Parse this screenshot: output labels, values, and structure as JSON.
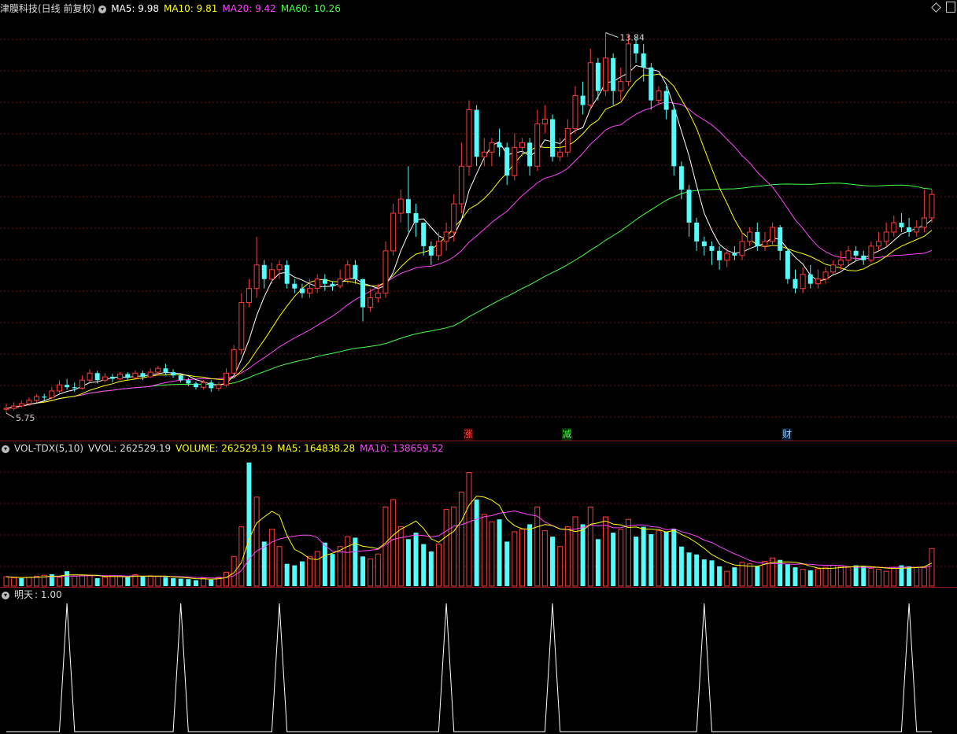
{
  "header_price": {
    "title": "津膜科技(日线 前复权)",
    "ma5": "MA5: 9.98",
    "ma10": "MA10: 9.81",
    "ma20": "MA20: 9.42",
    "ma60": "MA60: 10.26",
    "colors": {
      "title": "#dddddd",
      "ma5": "#ffffff",
      "ma10": "#ffff00",
      "ma20": "#ff44ff",
      "ma60": "#44ff44"
    }
  },
  "header_volume": {
    "name": "VOL-TDX(5,10)",
    "vvol": "VVOL: 262529.19",
    "volume": "VOLUME: 262529.19",
    "ma5": "MA5: 164838.28",
    "ma10": "MA10: 138659.52"
  },
  "header_signal": {
    "name": "明天",
    "value": ": 1.00"
  },
  "annotations": {
    "high_label": "13.84",
    "low_label": "5.75"
  },
  "markers": [
    {
      "label": "涨",
      "color": "#ff4444",
      "bg": "#330000"
    },
    {
      "label": "减",
      "color": "#44ff44",
      "bg": "#003300"
    },
    {
      "label": "财",
      "color": "#88ccff",
      "bg": "#001a33"
    }
  ],
  "colors": {
    "up": "#ff3b3b",
    "down": "#54fcfc",
    "grid": "#6b0f0f",
    "separator": "#8b1a1a",
    "ma5": "#ffffff",
    "ma10": "#ffff00",
    "ma20": "#ff44ff",
    "ma60": "#44ff44",
    "signal": "#ffffff"
  },
  "chart_data": {
    "type": "candlestick",
    "price_range": [
      5.5,
      14.2
    ],
    "volume_range": [
      0,
      262600
    ],
    "candles": [
      [
        5.83,
        5.85,
        5.75,
        5.95
      ],
      [
        5.85,
        5.9,
        5.8,
        5.98
      ],
      [
        5.9,
        5.95,
        5.86,
        6.02
      ],
      [
        5.95,
        6.02,
        5.9,
        6.08
      ],
      [
        6.02,
        6.1,
        5.98,
        6.15
      ],
      [
        6.1,
        6.08,
        6.02,
        6.16
      ],
      [
        6.08,
        6.22,
        6.05,
        6.3
      ],
      [
        6.22,
        6.35,
        6.18,
        6.45
      ],
      [
        6.35,
        6.3,
        6.25,
        6.48
      ],
      [
        6.3,
        6.28,
        6.2,
        6.4
      ],
      [
        6.28,
        6.45,
        6.25,
        6.55
      ],
      [
        6.45,
        6.6,
        6.4,
        6.68
      ],
      [
        6.6,
        6.45,
        6.38,
        6.65
      ],
      [
        6.45,
        6.52,
        6.4,
        6.6
      ],
      [
        6.52,
        6.48,
        6.4,
        6.58
      ],
      [
        6.48,
        6.58,
        6.45,
        6.62
      ],
      [
        6.58,
        6.5,
        6.45,
        6.62
      ],
      [
        6.5,
        6.6,
        6.48,
        6.66
      ],
      [
        6.6,
        6.52,
        6.45,
        6.65
      ],
      [
        6.52,
        6.62,
        6.5,
        6.7
      ],
      [
        6.62,
        6.7,
        6.55,
        6.75
      ],
      [
        6.7,
        6.62,
        6.55,
        6.8
      ],
      [
        6.62,
        6.55,
        6.5,
        6.68
      ],
      [
        6.55,
        6.45,
        6.4,
        6.6
      ],
      [
        6.45,
        6.38,
        6.32,
        6.5
      ],
      [
        6.38,
        6.3,
        6.25,
        6.42
      ],
      [
        6.3,
        6.4,
        6.25,
        6.45
      ],
      [
        6.4,
        6.28,
        6.2,
        6.45
      ],
      [
        6.28,
        6.35,
        6.22,
        6.42
      ],
      [
        6.35,
        6.6,
        6.3,
        6.7
      ],
      [
        6.6,
        7.1,
        6.55,
        7.2
      ],
      [
        7.1,
        8.1,
        7.0,
        8.3
      ],
      [
        8.1,
        8.4,
        8.0,
        8.6
      ],
      [
        8.4,
        8.9,
        8.2,
        9.5
      ],
      [
        8.9,
        8.6,
        8.4,
        9.0
      ],
      [
        8.6,
        8.8,
        8.5,
        8.95
      ],
      [
        8.8,
        8.9,
        8.6,
        9.0
      ],
      [
        8.9,
        8.5,
        8.4,
        9.0
      ],
      [
        8.5,
        8.4,
        8.3,
        8.6
      ],
      [
        8.4,
        8.3,
        8.2,
        8.5
      ],
      [
        8.3,
        8.4,
        8.2,
        8.6
      ],
      [
        8.4,
        8.6,
        8.3,
        8.7
      ],
      [
        8.6,
        8.5,
        8.35,
        8.7
      ],
      [
        8.5,
        8.45,
        8.35,
        8.55
      ],
      [
        8.45,
        8.6,
        8.4,
        8.8
      ],
      [
        8.6,
        8.9,
        8.5,
        9.0
      ],
      [
        8.9,
        8.6,
        8.5,
        9.0
      ],
      [
        8.6,
        8.0,
        7.7,
        8.6
      ],
      [
        8.0,
        8.2,
        7.9,
        8.4
      ],
      [
        8.2,
        8.3,
        8.1,
        8.5
      ],
      [
        8.3,
        9.2,
        8.2,
        9.4
      ],
      [
        9.2,
        10.0,
        9.1,
        10.2
      ],
      [
        10.0,
        10.3,
        9.8,
        10.5
      ],
      [
        10.3,
        10.0,
        9.6,
        11.0
      ],
      [
        10.0,
        9.8,
        9.5,
        10.2
      ],
      [
        9.8,
        9.3,
        9.1,
        9.8
      ],
      [
        9.3,
        9.1,
        8.9,
        9.4
      ],
      [
        9.1,
        9.4,
        9.0,
        9.6
      ],
      [
        9.4,
        9.6,
        9.2,
        9.8
      ],
      [
        9.6,
        10.2,
        9.4,
        10.4
      ],
      [
        10.2,
        11.0,
        10.0,
        11.5
      ],
      [
        11.0,
        12.2,
        10.8,
        12.4
      ],
      [
        12.2,
        11.2,
        11.0,
        12.3
      ],
      [
        11.2,
        11.3,
        11.0,
        11.6
      ],
      [
        11.3,
        11.5,
        11.0,
        11.6
      ],
      [
        11.5,
        11.4,
        11.2,
        11.8
      ],
      [
        11.4,
        10.8,
        10.6,
        11.5
      ],
      [
        10.8,
        11.4,
        10.7,
        11.7
      ],
      [
        11.4,
        11.5,
        11.2,
        11.6
      ],
      [
        11.5,
        11.0,
        10.8,
        11.6
      ],
      [
        11.0,
        11.9,
        10.9,
        12.2
      ],
      [
        11.9,
        12.0,
        11.7,
        12.3
      ],
      [
        12.0,
        11.2,
        11.1,
        12.1
      ],
      [
        11.2,
        11.3,
        11.1,
        11.6
      ],
      [
        11.3,
        11.8,
        11.2,
        12.0
      ],
      [
        11.8,
        12.5,
        11.7,
        12.7
      ],
      [
        12.5,
        12.3,
        12.1,
        12.8
      ],
      [
        12.3,
        13.2,
        12.2,
        13.5
      ],
      [
        13.2,
        12.6,
        12.4,
        13.3
      ],
      [
        12.6,
        13.3,
        12.5,
        13.84
      ],
      [
        13.3,
        12.6,
        12.3,
        13.4
      ],
      [
        12.6,
        12.8,
        12.4,
        13.1
      ],
      [
        12.8,
        13.6,
        12.7,
        13.8
      ],
      [
        13.6,
        13.4,
        13.2,
        13.75
      ],
      [
        13.4,
        13.1,
        12.8,
        13.6
      ],
      [
        13.1,
        12.4,
        12.2,
        13.2
      ],
      [
        12.4,
        12.6,
        12.3,
        12.7
      ],
      [
        12.6,
        12.2,
        12.0,
        12.7
      ],
      [
        12.2,
        11.0,
        10.8,
        12.3
      ],
      [
        11.0,
        10.5,
        10.3,
        11.1
      ],
      [
        10.5,
        9.8,
        9.5,
        10.6
      ],
      [
        9.8,
        9.4,
        9.2,
        9.9
      ],
      [
        9.4,
        9.3,
        9.1,
        9.5
      ],
      [
        9.3,
        9.2,
        8.9,
        9.4
      ],
      [
        9.2,
        9.0,
        8.8,
        9.3
      ],
      [
        9.0,
        9.15,
        8.85,
        9.25
      ],
      [
        9.15,
        9.1,
        9.0,
        9.3
      ],
      [
        9.1,
        9.4,
        9.0,
        9.6
      ],
      [
        9.4,
        9.6,
        9.3,
        9.7
      ],
      [
        9.6,
        9.3,
        9.2,
        9.8
      ],
      [
        9.3,
        9.4,
        9.2,
        9.6
      ],
      [
        9.4,
        9.7,
        9.3,
        9.8
      ],
      [
        9.7,
        9.2,
        9.0,
        9.75
      ],
      [
        9.2,
        8.6,
        8.5,
        9.25
      ],
      [
        8.6,
        8.4,
        8.3,
        8.8
      ],
      [
        8.4,
        8.7,
        8.3,
        8.85
      ],
      [
        8.7,
        8.5,
        8.4,
        8.9
      ],
      [
        8.5,
        8.6,
        8.4,
        8.8
      ],
      [
        8.6,
        8.75,
        8.5,
        8.85
      ],
      [
        8.75,
        8.9,
        8.7,
        9.0
      ],
      [
        8.9,
        9.0,
        8.8,
        9.2
      ],
      [
        9.0,
        9.2,
        8.9,
        9.3
      ],
      [
        9.2,
        9.1,
        9.0,
        9.3
      ],
      [
        9.1,
        9.0,
        8.9,
        9.2
      ],
      [
        9.0,
        9.3,
        8.95,
        9.4
      ],
      [
        9.3,
        9.4,
        9.2,
        9.6
      ],
      [
        9.4,
        9.6,
        9.3,
        9.8
      ],
      [
        9.6,
        9.8,
        9.5,
        9.95
      ],
      [
        9.8,
        9.7,
        9.6,
        10.0
      ],
      [
        9.7,
        9.6,
        9.5,
        9.9
      ],
      [
        9.6,
        9.7,
        9.5,
        9.85
      ],
      [
        9.7,
        9.9,
        9.6,
        10.5
      ],
      [
        9.9,
        10.4,
        9.8,
        10.5
      ]
    ],
    "volumes": [
      19000,
      17000,
      16000,
      18000,
      20000,
      22000,
      24000,
      18000,
      30000,
      20000,
      22000,
      21000,
      16000,
      18000,
      21000,
      20000,
      18000,
      23000,
      19000,
      21000,
      20000,
      18000,
      16000,
      15000,
      14000,
      12000,
      16000,
      13000,
      18000,
      28000,
      60000,
      120000,
      250000,
      180000,
      90000,
      115000,
      80000,
      45000,
      42000,
      50000,
      60000,
      70000,
      88000,
      65000,
      80000,
      100000,
      98000,
      60000,
      55000,
      65000,
      160000,
      175000,
      120000,
      95000,
      108000,
      85000,
      70000,
      85000,
      155000,
      160000,
      190000,
      230000,
      175000,
      145000,
      130000,
      135000,
      90000,
      110000,
      115000,
      125000,
      160000,
      112000,
      100000,
      80000,
      120000,
      140000,
      125000,
      160000,
      95000,
      140000,
      108000,
      115000,
      135000,
      100000,
      120000,
      105000,
      112000,
      110000,
      116000,
      80000,
      68000,
      64000,
      54000,
      52000,
      40000,
      30000,
      38000,
      48000,
      45000,
      40000,
      50000,
      57000,
      53000,
      44000,
      38000,
      34000,
      32000,
      35000,
      38000,
      42000,
      40000,
      38000,
      42000,
      40000,
      36000,
      34000,
      30000,
      38000,
      42000,
      40000,
      38000,
      37000,
      76000
    ],
    "volume_colors": [
      1,
      1,
      0,
      1,
      1,
      1,
      0,
      1,
      0,
      1,
      1,
      1,
      0,
      1,
      1,
      1,
      0,
      1,
      0,
      1,
      1,
      0,
      0,
      0,
      0,
      0,
      1,
      0,
      1,
      1,
      1,
      1,
      0,
      1,
      0,
      1,
      1,
      0,
      0,
      0,
      1,
      1,
      0,
      0,
      1,
      1,
      0,
      0,
      1,
      1,
      1,
      1,
      1,
      0,
      0,
      0,
      0,
      1,
      1,
      1,
      1,
      1,
      0,
      1,
      1,
      0,
      0,
      1,
      1,
      0,
      1,
      1,
      0,
      1,
      1,
      1,
      0,
      1,
      0,
      1,
      0,
      1,
      1,
      0,
      0,
      0,
      1,
      0,
      0,
      0,
      0,
      0,
      0,
      0,
      0,
      1,
      0,
      1,
      1,
      0,
      1,
      1,
      0,
      0,
      0,
      1,
      0,
      1,
      1,
      1,
      1,
      1,
      0,
      0,
      1,
      1,
      1,
      1,
      0,
      0,
      1,
      1,
      1
    ],
    "signal_days": [
      8,
      23,
      36,
      58,
      72,
      92,
      119
    ],
    "signal_value": 1.0
  }
}
